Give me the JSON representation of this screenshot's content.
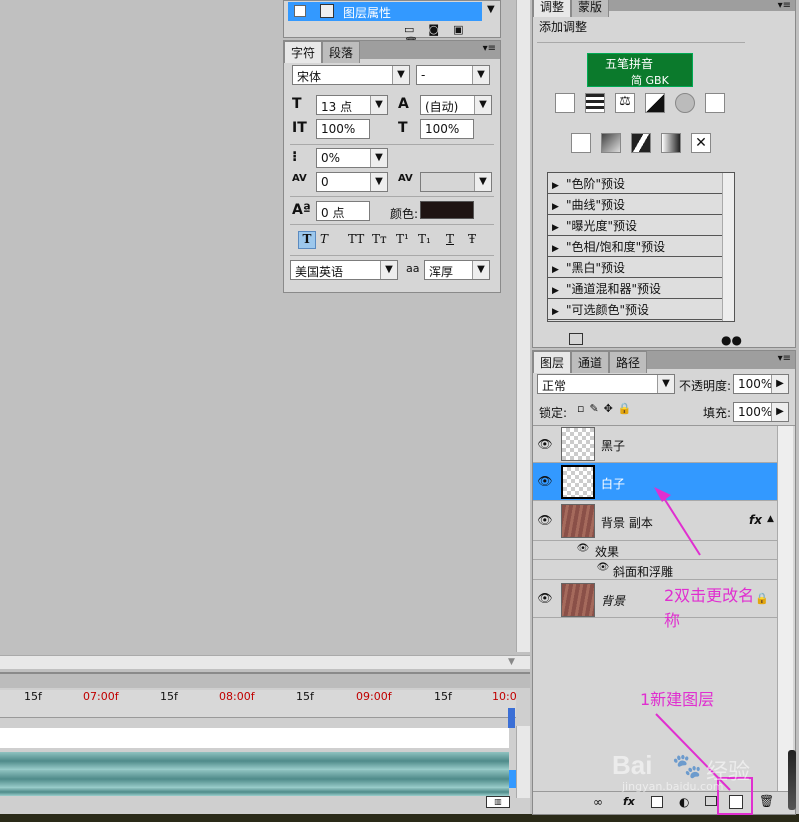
{
  "layer_props_menu": {
    "item": "图层属性"
  },
  "char_panel": {
    "tabs": [
      "字符",
      "段落"
    ],
    "font_family": "宋体",
    "font_style": "-",
    "font_size": "13 点",
    "leading": "(自动)",
    "vertical_scale": "100%",
    "horizontal_scale": "100%",
    "tsume": "0%",
    "kerning": "0",
    "tracking": "",
    "baseline_shift": "0 点",
    "color_label": "颜色:",
    "color": "#1e1412",
    "style_buttons": [
      "T",
      "T",
      "TT",
      "Tт",
      "T¹",
      "T₁",
      "T",
      "Ŧ"
    ],
    "language": "美国英语",
    "aa_label": "aa",
    "antialias": "浑厚"
  },
  "adjust_panel": {
    "tabs": [
      "调整",
      "蒙版"
    ],
    "heading": "添加调整",
    "ime": {
      "line1": "五笔拼音",
      "line2": "简 GBK"
    },
    "presets": [
      "\"色阶\"预设",
      "\"曲线\"预设",
      "\"曝光度\"预设",
      "\"色相/饱和度\"预设",
      "\"黑白\"预设",
      "\"通道混和器\"预设",
      "\"可选颜色\"预设"
    ]
  },
  "layers_panel": {
    "tabs": [
      "图层",
      "通道",
      "路径"
    ],
    "blend_mode": "正常",
    "opacity_label": "不透明度:",
    "opacity": "100%",
    "lock_label": "锁定:",
    "fill_label": "填充:",
    "fill": "100%",
    "layers": [
      {
        "name": "黑子"
      },
      {
        "name": "白子"
      },
      {
        "name": "背景 副本",
        "fx": "fx"
      },
      {
        "effects": "效果",
        "effect": "斜面和浮雕"
      },
      {
        "name": "背景"
      }
    ]
  },
  "timeline": {
    "labels": [
      "15f",
      "07:00f",
      "15f",
      "08:00f",
      "15f",
      "09:00f",
      "15f",
      "10:0"
    ]
  },
  "annotations": {
    "rename": "2双击更改名",
    "rename2": "称",
    "new_layer": "1新建图层"
  },
  "watermark": {
    "brand": "Bai",
    "brand2": "经验",
    "url": "jingyan.baidu.com"
  },
  "colors": {
    "selection": "#3399ff",
    "annotation": "#e02fd0",
    "red_time": "#c00000"
  }
}
